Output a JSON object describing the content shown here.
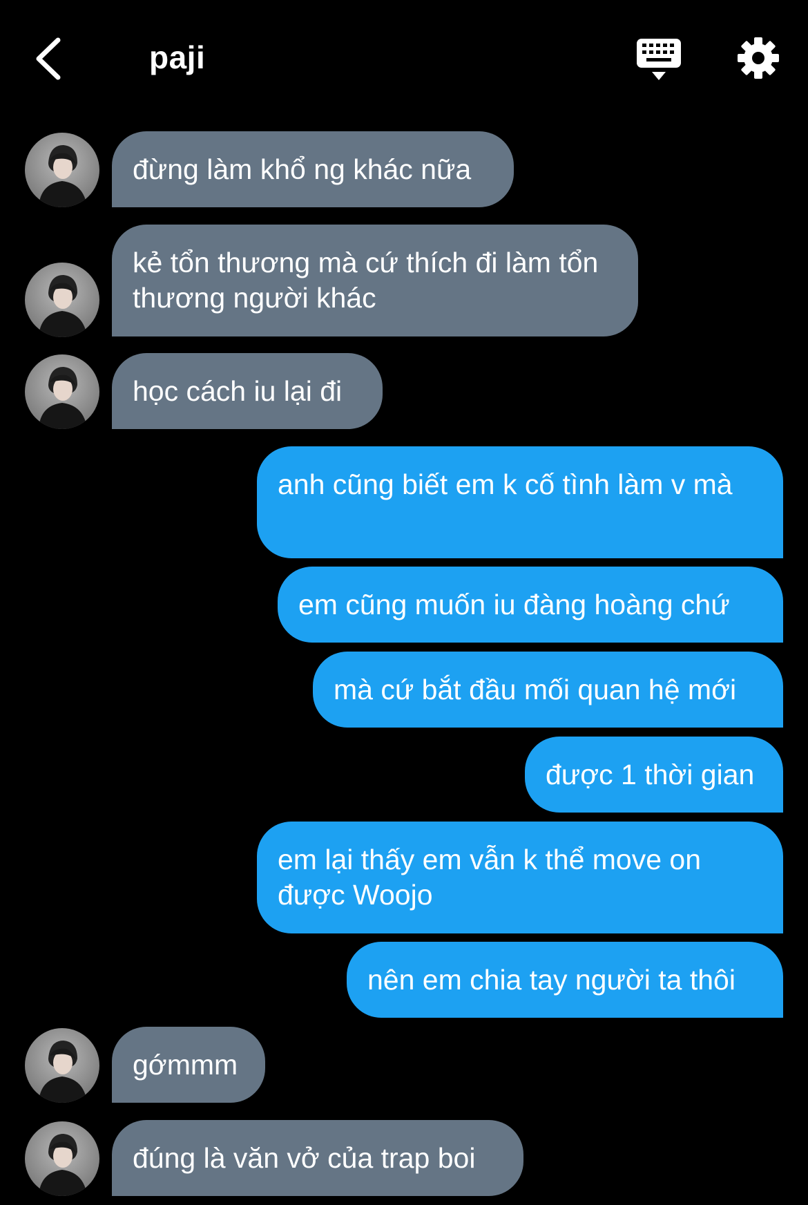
{
  "header": {
    "title": "paji"
  },
  "messages": [
    {
      "sender": "them",
      "text": "đừng làm khổ ng khác nữa"
    },
    {
      "sender": "them",
      "text": "kẻ tổn thương mà cứ thích đi làm tổn thương người khác"
    },
    {
      "sender": "them",
      "text": "học cách iu lại đi"
    },
    {
      "sender": "me",
      "text": "anh cũng biết em k cố tình làm v mà"
    },
    {
      "sender": "me",
      "text": "em cũng muốn iu đàng hoàng chứ"
    },
    {
      "sender": "me",
      "text": "mà cứ bắt đầu mối quan hệ mới"
    },
    {
      "sender": "me",
      "text": "được 1 thời gian"
    },
    {
      "sender": "me",
      "text": "em lại thấy em vẫn k thể move on được Woojo"
    },
    {
      "sender": "me",
      "text": "nên em chia tay người ta thôi"
    },
    {
      "sender": "them",
      "text": "gớmmm"
    },
    {
      "sender": "them",
      "text": "đúng là văn vở của trap boi"
    }
  ],
  "icons": {
    "back": "chevron-left-icon",
    "keyboard": "keyboard-icon",
    "settings": "gear-icon"
  },
  "colors": {
    "background": "#000000",
    "incoming_bubble": "#657585",
    "outgoing_bubble": "#1da1f2",
    "text": "#ffffff"
  }
}
